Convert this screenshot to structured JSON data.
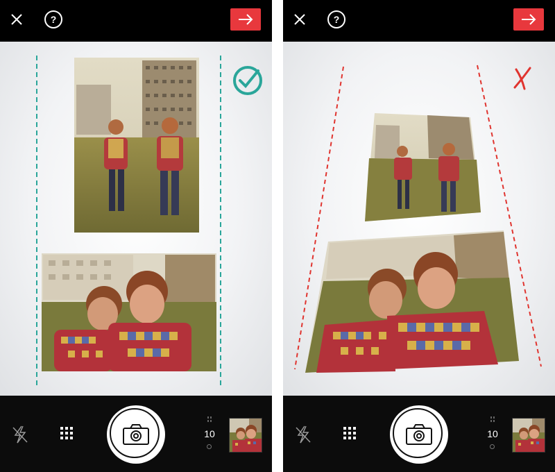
{
  "screens": [
    {
      "id": "accepted",
      "status_icon": "check-circle-icon",
      "guide_color": "#2aa69a",
      "capture_count": "10"
    },
    {
      "id": "rejected",
      "status_icon": "x-mark-icon",
      "guide_color": "#e0342f",
      "capture_count": "10"
    }
  ],
  "icons": {
    "close": "close-icon",
    "help": "help-icon",
    "next": "arrow-right-icon",
    "flash": "flash-off-icon",
    "grid": "grid-icon",
    "shutter": "camera-icon"
  },
  "colors": {
    "accent_red": "#e8383d",
    "check_teal": "#2aa69a",
    "reject_red": "#e0342f"
  },
  "help_label": "?"
}
